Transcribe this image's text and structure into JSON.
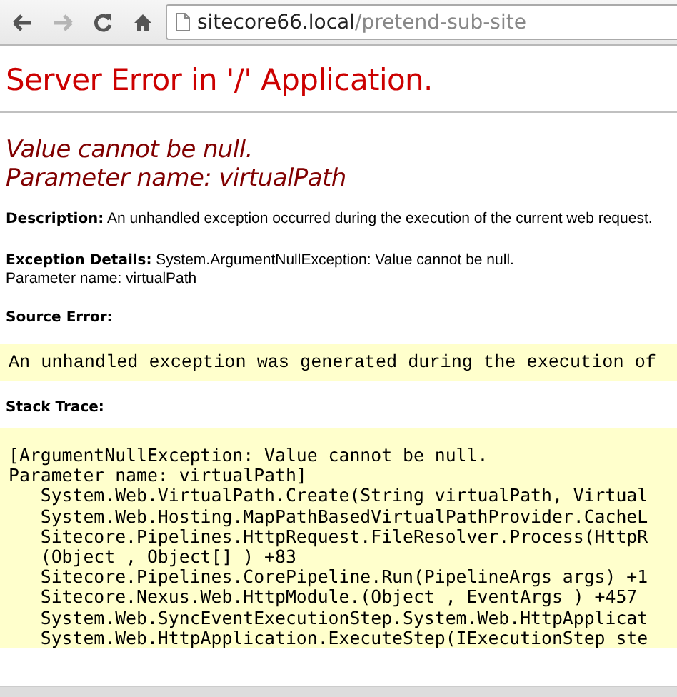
{
  "toolbar": {
    "back": {
      "disabled": false
    },
    "forward": {
      "disabled": true
    },
    "address": {
      "host": "sitecore66.local",
      "path": "/pretend-sub-site"
    }
  },
  "page": {
    "title": "Server Error in '/' Application.",
    "error_message": [
      "Value cannot be null.",
      "Parameter name: virtualPath"
    ],
    "description": {
      "label": "Description:",
      "text": "An unhandled exception occurred during the execution of the current web request."
    },
    "exception_details": {
      "label": "Exception Details:",
      "text": "System.ArgumentNullException: Value cannot be null.",
      "parameter": "Parameter name: virtualPath"
    },
    "source_error": {
      "label": "Source Error:",
      "text": "An unhandled exception was generated during the execution of"
    },
    "stack_trace": {
      "label": "Stack Trace:",
      "lines": [
        "[ArgumentNullException: Value cannot be null.",
        "Parameter name: virtualPath]",
        "   System.Web.VirtualPath.Create(String virtualPath, Virtual",
        "   System.Web.Hosting.MapPathBasedVirtualPathProvider.CacheL",
        "   Sitecore.Pipelines.HttpRequest.FileResolver.Process(HttpR",
        "   (Object , Object[] ) +83",
        "   Sitecore.Pipelines.CorePipeline.Run(PipelineArgs args) +1",
        "   Sitecore.Nexus.Web.HttpModule.(Object , EventArgs ) +457",
        "   System.Web.SyncEventExecutionStep.System.Web.HttpApplicat",
        "   System.Web.HttpApplication.ExecuteStep(IExecutionStep ste"
      ]
    }
  }
}
